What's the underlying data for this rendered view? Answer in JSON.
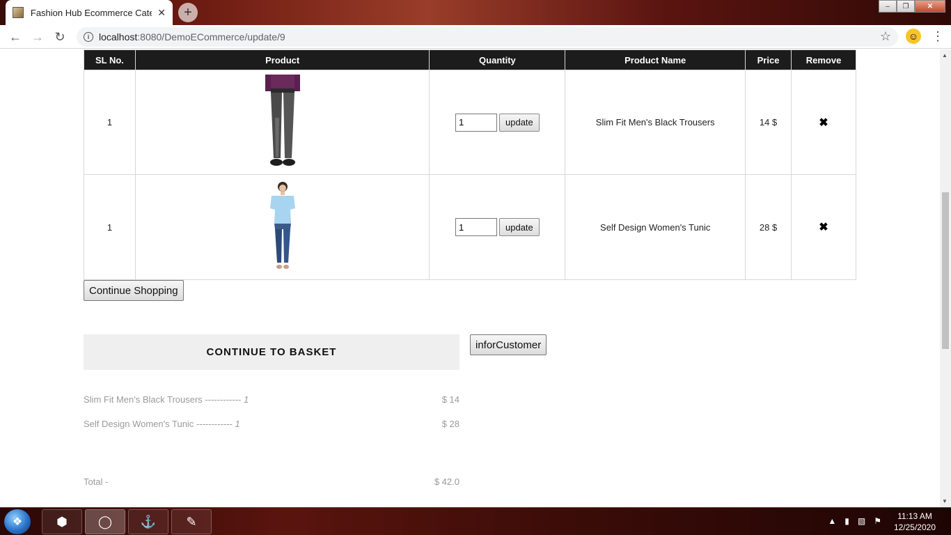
{
  "browser": {
    "tab_title": "Fashion Hub Ecommerce Catego",
    "tab_close": "✕",
    "new_tab": "+",
    "url_host": "localhost",
    "url_path": ":8080/DemoECommerce/update/9",
    "window_controls": [
      "–",
      "❐",
      "✕"
    ]
  },
  "cart": {
    "headers": [
      "SL No.",
      "Product",
      "Quantity",
      "Product Name",
      "Price",
      "Remove"
    ],
    "rows": [
      {
        "sl": "1",
        "qty": "1",
        "update_label": "update",
        "name": "Slim Fit Men's Black Trousers",
        "price": "14 $",
        "remove": "✖"
      },
      {
        "sl": "1",
        "qty": "1",
        "update_label": "update",
        "name": "Self Design Women's Tunic",
        "price": "28 $",
        "remove": "✖"
      }
    ]
  },
  "actions": {
    "continue_shopping": "Continue Shopping",
    "continue_to_basket": "CONTINUE TO BASKET",
    "infor_customer": "inforCustomer"
  },
  "summary": {
    "items": [
      {
        "name": "Slim Fit Men's Black Trousers",
        "dashes": "------------",
        "qty": "1",
        "price": "$ 14"
      },
      {
        "name": "Self Design Women's Tunic",
        "dashes": "------------",
        "qty": "1",
        "price": "$ 28"
      }
    ],
    "total_label": "Total -",
    "total_value": "$ 42.0"
  },
  "taskbar": {
    "time": "11:13 AM",
    "date": "12/25/2020"
  },
  "colors": {
    "table_header_bg": "#1c1c1c",
    "basket_bg": "#efefef",
    "summary_text": "#9a9a9a"
  }
}
